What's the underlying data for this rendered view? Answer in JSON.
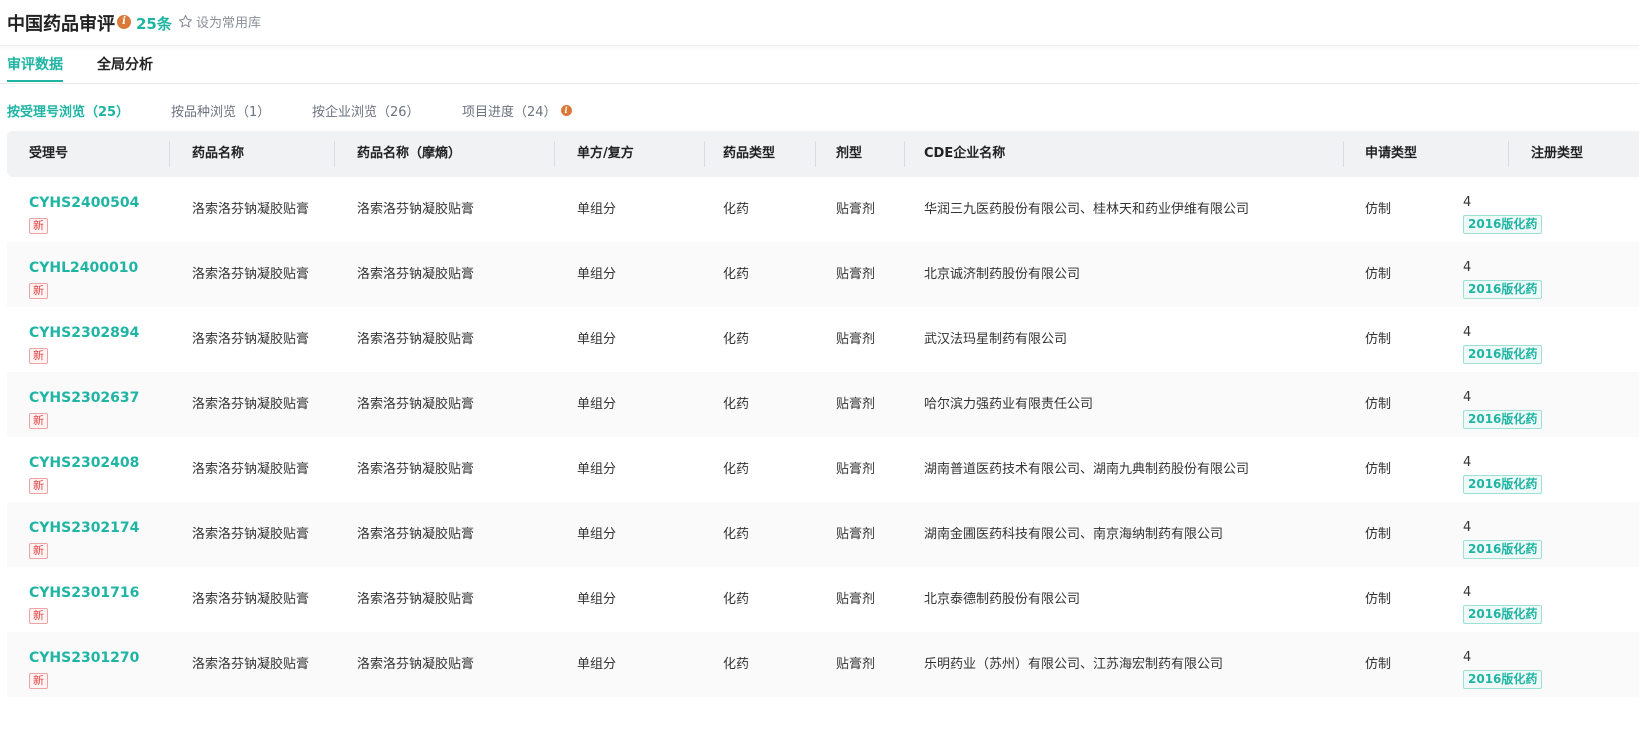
{
  "header": {
    "title": "中国药品审评",
    "count": "25条",
    "favorite_label": "设为常用库"
  },
  "tabs": [
    {
      "label": "审评数据",
      "active": true
    },
    {
      "label": "全局分析",
      "active": false
    }
  ],
  "subtabs": [
    {
      "label": "按受理号浏览（25）",
      "active": true
    },
    {
      "label": "按品种浏览（1）",
      "active": false
    },
    {
      "label": "按企业浏览（26）",
      "active": false
    },
    {
      "label": "项目进度（24）",
      "active": false
    }
  ],
  "table": {
    "columns": [
      "受理号",
      "药品名称",
      "药品名称（摩熵）",
      "单方/复方",
      "药品类型",
      "剂型",
      "CDE企业名称",
      "申请类型",
      "注册类型"
    ],
    "new_badge": "新",
    "rows": [
      {
        "id": "CYHS2400504",
        "name": "洛索洛芬钠凝胶贴膏",
        "name_moshang": "洛索洛芬钠凝胶贴膏",
        "compound": "单组分",
        "drug_type": "化药",
        "form": "贴膏剂",
        "company": "华润三九医药股份有限公司、桂林天和药业伊维有限公司",
        "apply_type": "仿制",
        "reg_class": "4",
        "reg_badge": "2016版化药"
      },
      {
        "id": "CYHL2400010",
        "name": "洛索洛芬钠凝胶贴膏",
        "name_moshang": "洛索洛芬钠凝胶贴膏",
        "compound": "单组分",
        "drug_type": "化药",
        "form": "贴膏剂",
        "company": "北京诚济制药股份有限公司",
        "apply_type": "仿制",
        "reg_class": "4",
        "reg_badge": "2016版化药"
      },
      {
        "id": "CYHS2302894",
        "name": "洛索洛芬钠凝胶贴膏",
        "name_moshang": "洛索洛芬钠凝胶贴膏",
        "compound": "单组分",
        "drug_type": "化药",
        "form": "贴膏剂",
        "company": "武汉法玛星制药有限公司",
        "apply_type": "仿制",
        "reg_class": "4",
        "reg_badge": "2016版化药"
      },
      {
        "id": "CYHS2302637",
        "name": "洛索洛芬钠凝胶贴膏",
        "name_moshang": "洛索洛芬钠凝胶贴膏",
        "compound": "单组分",
        "drug_type": "化药",
        "form": "贴膏剂",
        "company": "哈尔滨力强药业有限责任公司",
        "apply_type": "仿制",
        "reg_class": "4",
        "reg_badge": "2016版化药"
      },
      {
        "id": "CYHS2302408",
        "name": "洛索洛芬钠凝胶贴膏",
        "name_moshang": "洛索洛芬钠凝胶贴膏",
        "compound": "单组分",
        "drug_type": "化药",
        "form": "贴膏剂",
        "company": "湖南普道医药技术有限公司、湖南九典制药股份有限公司",
        "apply_type": "仿制",
        "reg_class": "4",
        "reg_badge": "2016版化药"
      },
      {
        "id": "CYHS2302174",
        "name": "洛索洛芬钠凝胶贴膏",
        "name_moshang": "洛索洛芬钠凝胶贴膏",
        "compound": "单组分",
        "drug_type": "化药",
        "form": "贴膏剂",
        "company": "湖南金圃医药科技有限公司、南京海纳制药有限公司",
        "apply_type": "仿制",
        "reg_class": "4",
        "reg_badge": "2016版化药"
      },
      {
        "id": "CYHS2301716",
        "name": "洛索洛芬钠凝胶贴膏",
        "name_moshang": "洛索洛芬钠凝胶贴膏",
        "compound": "单组分",
        "drug_type": "化药",
        "form": "贴膏剂",
        "company": "北京泰德制药股份有限公司",
        "apply_type": "仿制",
        "reg_class": "4",
        "reg_badge": "2016版化药"
      },
      {
        "id": "CYHS2301270",
        "name": "洛索洛芬钠凝胶贴膏",
        "name_moshang": "洛索洛芬钠凝胶贴膏",
        "compound": "单组分",
        "drug_type": "化药",
        "form": "贴膏剂",
        "company": "乐明药业（苏州）有限公司、江苏海宏制药有限公司",
        "apply_type": "仿制",
        "reg_class": "4",
        "reg_badge": "2016版化药"
      }
    ]
  },
  "colors": {
    "accent": "#1fb4a3",
    "info_icon": "#d97a3a",
    "new_badge": "#e24444"
  }
}
